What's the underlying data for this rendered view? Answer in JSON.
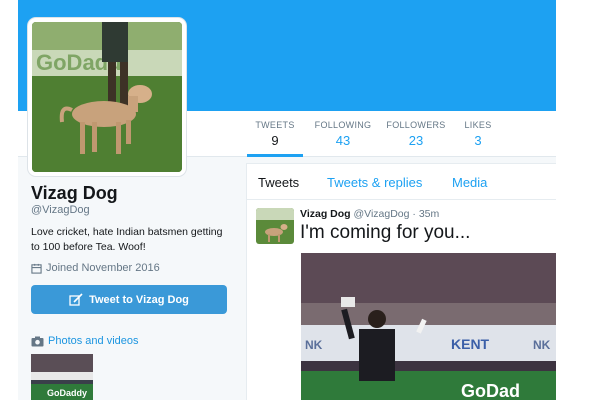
{
  "profile": {
    "name": "Vizag Dog",
    "handle": "@VizagDog",
    "bio": "Love cricket, hate Indian batsmen getting to 100 before Tea. Woof!",
    "joined": "Joined November 2016",
    "tweet_to_label": "Tweet to Vizag Dog",
    "photos_label": "Photos and videos"
  },
  "stats": [
    {
      "label": "TWEETS",
      "value": "9"
    },
    {
      "label": "FOLLOWING",
      "value": "43"
    },
    {
      "label": "FOLLOWERS",
      "value": "23"
    },
    {
      "label": "LIKES",
      "value": "3"
    }
  ],
  "tabs": [
    "Tweets",
    "Tweets & replies",
    "Media"
  ],
  "tweet": {
    "name": "Vizag Dog",
    "handle": "@VizagDog",
    "time": "35m",
    "text": "I'm coming for you..."
  },
  "images": {
    "avatar_banner_text": "GoDadd",
    "photo_banner_text": "GoDaddy",
    "media_ad_left": "NK",
    "media_ad_mid": "KENT",
    "media_ad_right": "NK",
    "media_banner_text": "GoDad"
  },
  "colors": {
    "accent": "#1da1f2",
    "button": "#3a99d8",
    "text_muted": "#657786",
    "pitch_green": "#5b8a3a"
  },
  "icons": {
    "calendar": "calendar-icon",
    "compose": "compose-icon",
    "camera": "camera-icon"
  }
}
